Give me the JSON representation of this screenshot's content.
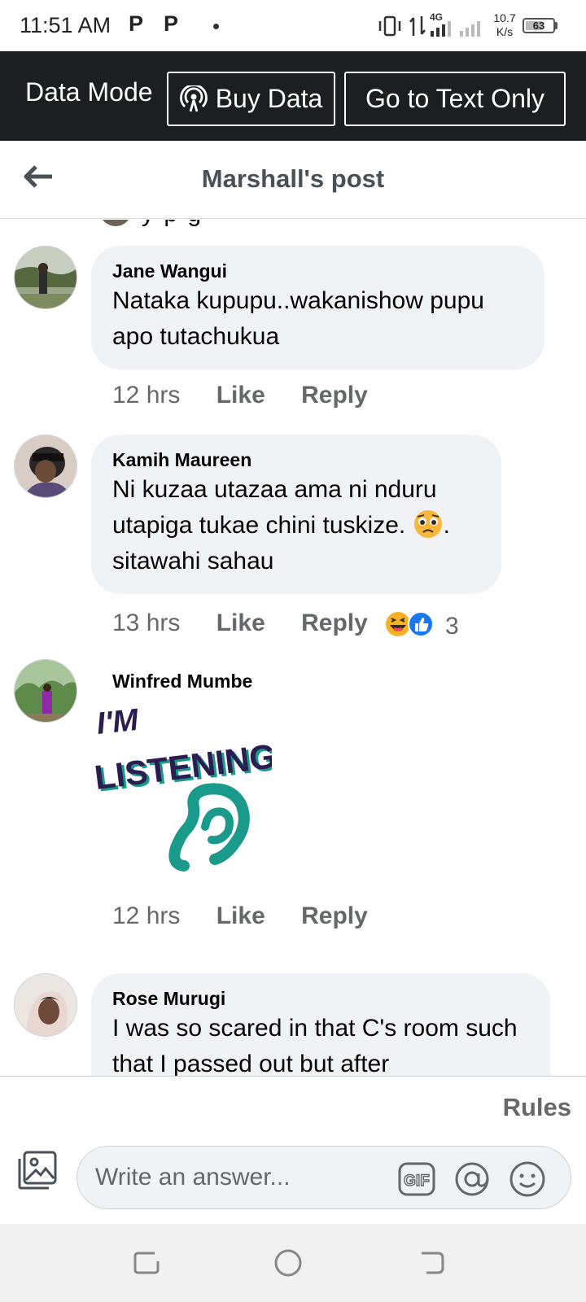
{
  "status_bar": {
    "time": "11:51 AM",
    "notif_1": "P",
    "notif_2": "P",
    "network_type": "4G",
    "net_speed_value": "10.7",
    "net_speed_unit": "K/s",
    "battery": "63",
    "battery_level": 0.63
  },
  "data_banner": {
    "label": "Data Mode",
    "buy_data": "Buy Data",
    "text_only": "Go to Text Only"
  },
  "header": {
    "title": "Marshall's post"
  },
  "partial_comment_text": "y   p              g",
  "comments": [
    {
      "author": "Jane Wangui",
      "text": "Nataka kupupu..wakanishow pupu apo tutachukua",
      "time": "12 hrs",
      "like": "Like",
      "reply": "Reply"
    },
    {
      "author": "Kamih Maureen",
      "text_line1": "Ni kuzaa utazaa ama ni nduru",
      "text_line2": "utapiga tukae chini tuskize.",
      "text_line2_end": ".",
      "text_line3": "sitawahi sahau",
      "time": "13 hrs",
      "like": "Like",
      "reply": "Reply",
      "reaction_count": "3"
    },
    {
      "author": "Winfred Mumbe",
      "sticker_text_1": "I'M",
      "sticker_text_2": "LISTENING",
      "time": "12 hrs",
      "like": "Like",
      "reply": "Reply"
    },
    {
      "author": "Rose Murugi",
      "text": "I was so scared in that C's room such that I passed out but after"
    }
  ],
  "rules": "Rules",
  "composer": {
    "placeholder": "Write an answer...",
    "gif_label": "GIF"
  },
  "colors": {
    "banner_bg": "#1c1e21",
    "bubble_bg": "#f0f2f5",
    "secondary_text": "#65676b",
    "sticker_teal": "#1a9a8a",
    "sticker_navy": "#2b1d4f"
  },
  "icons": [
    "back-arrow-icon",
    "antenna-icon",
    "photo-icon",
    "gif-icon",
    "mention-icon",
    "emoji-icon",
    "haha-reaction-icon",
    "like-reaction-icon",
    "pleading-face-emoji-icon"
  ]
}
